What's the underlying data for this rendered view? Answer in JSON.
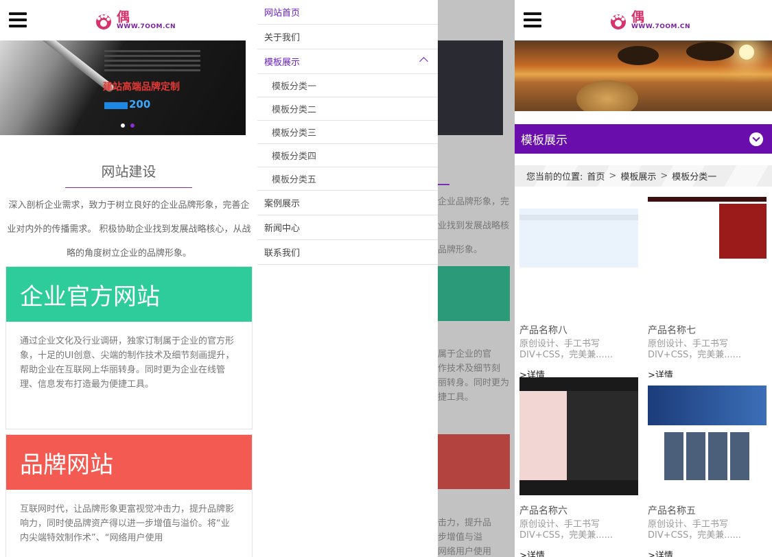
{
  "panel1": {
    "banner": {
      "headline": "建站高端品牌定制",
      "number": "200"
    },
    "section_title": "网站建设",
    "intro": "深入剖析企业需求，致力于树立良好的企业品牌形象，完善企业对内外的传播需求。 积极协助企业找到发展战略核心，从战略的角度树立企业的品牌形象。",
    "card1": {
      "title": "企业官方网站",
      "body": "通过企业文化及行业调研，独家订制属于企业的官方形象，十足的UI创意、尖端的制作技术及细节刻画提升，帮助企业在互联网上华丽转身。同时更为企业在线管理、信息发布打造最为便捷工具。"
    },
    "card2": {
      "title": "品牌网站",
      "body": "互联网时代，让品牌形象更富视觉冲击力，提升品牌影响力，同时使品牌资产得以进一步增值与溢价。将“业内尖端特效制作术”、“网络用户使用"
    }
  },
  "colors": {
    "accent": "#6a0dad",
    "green": "#2ecc9a",
    "red": "#f25a52"
  },
  "menu": {
    "items": [
      {
        "label": "网站首页"
      },
      {
        "label": "关于我们"
      },
      {
        "label": "模板展示"
      },
      {
        "label": "模板分类一"
      },
      {
        "label": "模板分类二"
      },
      {
        "label": "模板分类三"
      },
      {
        "label": "模板分类四"
      },
      {
        "label": "模板分类五"
      },
      {
        "label": "案例展示"
      },
      {
        "label": "新闻中心"
      },
      {
        "label": "联系我们"
      }
    ]
  },
  "overlay_ghost": {
    "l1": "企业品牌形象，完",
    "l2": "业找到发展战略核",
    "l3": "品牌形象。",
    "l4": "属于企业的官",
    "l5": "作技术及细节刻",
    "l6": "丽转身。同时更为",
    "l7": "捷工具。",
    "l8": "击力，提升品",
    "l9": "步增值与溢",
    "l10": "网络用户使用"
  },
  "panel3": {
    "category": "模板展示",
    "crumbs": {
      "prefix": "您当前的位置:",
      "home": "首页",
      "level1": "模板展示",
      "level2": "模板分类一",
      "sep": ">"
    },
    "products": [
      {
        "name": "产品名称八",
        "desc": "原创设计、手工书写DIV+CSS，完美兼......",
        "more": ">详情"
      },
      {
        "name": "产品名称七",
        "desc": "原创设计、手工书写DIV+CSS，完美兼......",
        "more": ">详情"
      },
      {
        "name": "产品名称六",
        "desc": "原创设计、手工书写DIV+CSS，完美兼......",
        "more": ">详情"
      },
      {
        "name": "产品名称五",
        "desc": "原创设计、手工书写DIV+CSS，完美兼......",
        "more": ">详情"
      }
    ]
  },
  "logo": {
    "main": "偶",
    "url": "WWW.7OOM.CN"
  }
}
